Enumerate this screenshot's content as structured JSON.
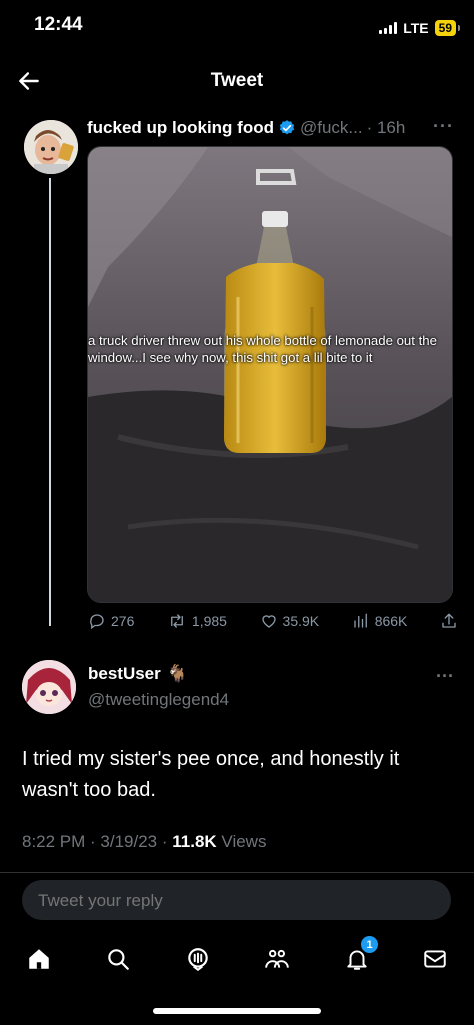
{
  "status_bar": {
    "time": "12:44",
    "network": "LTE",
    "battery": "59"
  },
  "header": {
    "title": "Tweet"
  },
  "quoted_tweet": {
    "display_name": "fucked up looking food",
    "handle": "@fuck...",
    "time": "· 16h",
    "image_caption": "a truck driver threw out his whole bottle of lemonade out the window...I see why now, this shit got a lil bite to it",
    "stats": {
      "replies": "276",
      "retweets": "1,985",
      "likes": "35.9K",
      "views": "866K"
    }
  },
  "reply_tweet": {
    "display_name": "bestUser",
    "emoji": "🐐",
    "handle": "@tweetinglegend4",
    "text": "I tried my sister's pee once, and honestly it wasn't too bad.",
    "timestamp": "8:22 PM · 3/19/23 · ",
    "views_count": "11.8K",
    "views_label": " Views"
  },
  "reply_box": {
    "placeholder": "Tweet your reply"
  },
  "bottom_nav": {
    "notifications_badge": "1"
  },
  "colors": {
    "accent": "#1d9bf0",
    "background": "#000000",
    "muted": "#71767b"
  }
}
